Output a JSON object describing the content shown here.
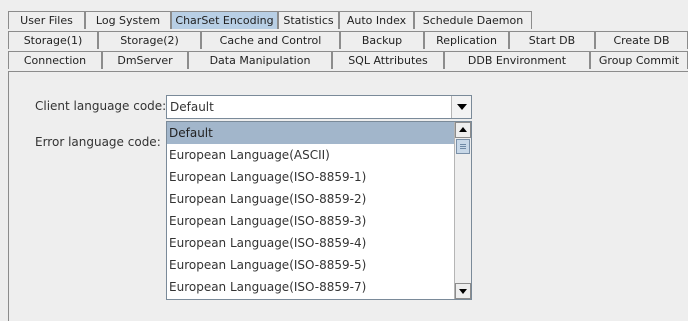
{
  "tabs": {
    "row1": [
      "User Files",
      "Log System",
      "CharSet Encoding",
      "Statistics",
      "Auto Index",
      "Schedule Daemon"
    ],
    "row2": [
      "Storage(1)",
      "Storage(2)",
      "Cache and Control",
      "Backup",
      "Replication",
      "Start DB",
      "Create DB"
    ],
    "row3": [
      "Connection",
      "DmServer",
      "Data Manipulation",
      "SQL Attributes",
      "DDB Environment",
      "Group Commit"
    ],
    "selected": "CharSet Encoding"
  },
  "form": {
    "client_language_label": "Client language code:",
    "error_language_label": "Error language code:",
    "client_language_value": "Default"
  },
  "dropdown": {
    "options": [
      "Default",
      "European Language(ASCII)",
      "European Language(ISO-8859-1)",
      "European Language(ISO-8859-2)",
      "European Language(ISO-8859-3)",
      "European Language(ISO-8859-4)",
      "European Language(ISO-8859-5)",
      "European Language(ISO-8859-7)"
    ],
    "selected_index": 0
  },
  "colors": {
    "selected_tab": "#b8cfe5",
    "selected_item": "#a2b6cb",
    "background": "#eeeeee"
  }
}
